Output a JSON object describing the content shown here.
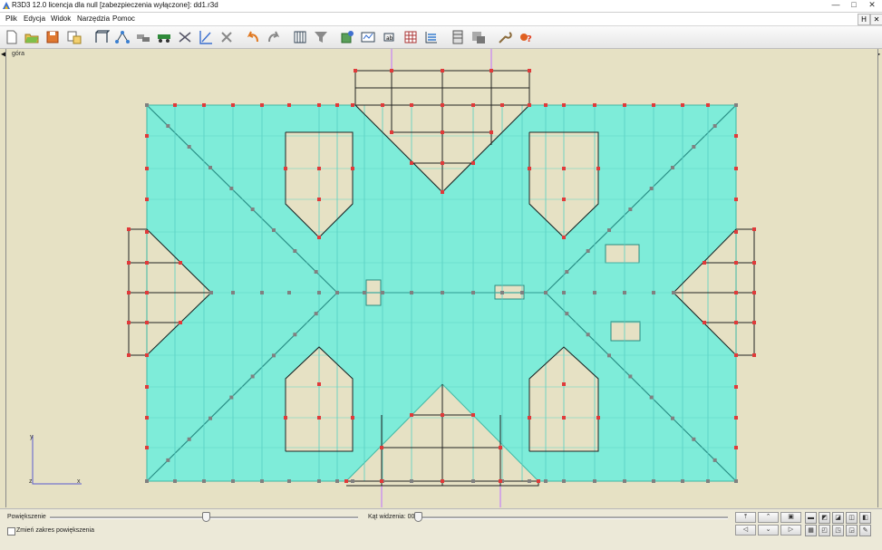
{
  "window": {
    "title": "R3D3 12.0 licencja dla null [zabezpieczenia wyłączone]: dd1.r3d",
    "minimize": "—",
    "maximize": "□",
    "close": "✕"
  },
  "menu": {
    "items": [
      "Plik",
      "Edycja",
      "Widok",
      "Narzędzia",
      "Pomoc"
    ],
    "mdi_buttons": [
      "H",
      "✕"
    ]
  },
  "toolbar": {
    "tools": [
      "new-file-icon",
      "open-folder-icon",
      "save-icon",
      "copy-properties-icon",
      "frame-icon",
      "node-connect-icon",
      "beam-icon",
      "load-truck-icon",
      "scissors-icon",
      "dimension-icon",
      "delete-icon",
      "undo-icon",
      "redo-icon",
      "table-icon",
      "filter-icon",
      "calculate-icon",
      "results-icon",
      "zoom-window-icon",
      "grid-icon",
      "layers-icon",
      "panel-icon",
      "stack-icon",
      "wrench-icon",
      "help-icon"
    ]
  },
  "viewport": {
    "label": "góra",
    "axis_y": "y",
    "axis_z": "z",
    "axis_x": "x",
    "left_arrow": "◀",
    "right_arrow": "▶"
  },
  "bottom": {
    "zoom_label": "Powiększenie",
    "zoom_range_label": "Zmień zakres powiększenia",
    "angle_label": "Kąt widzenia: 00",
    "view_buttons_row1": [
      "⤒",
      "⌃",
      "▣"
    ],
    "view_buttons_row2": [
      "◁",
      "⌄",
      "▷"
    ],
    "side_buttons_row1": [
      "▬",
      "◩",
      "◪",
      "◫",
      "◧"
    ],
    "side_buttons_row2": [
      "▦",
      "◰",
      "◳",
      "◲",
      "✎"
    ]
  },
  "colors": {
    "model_fill": "#7eecd9",
    "background": "#e6e1c4",
    "node": "#e03a3a",
    "node_grey": "#808080",
    "bar": "#222222",
    "axis_line": "#c070ff"
  }
}
